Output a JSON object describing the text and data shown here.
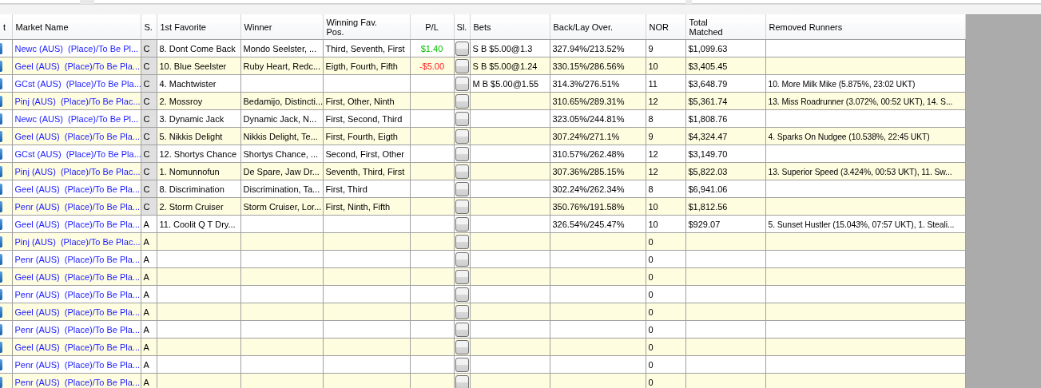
{
  "table": {
    "columns": [
      "t",
      "Market Name",
      "S.",
      "1st Favorite",
      "Winner",
      "Winning Fav.\nPos.",
      "P/L",
      "Sl.",
      "Bets",
      "Back/Lay Over.",
      "NOR",
      "Total\nMatched",
      "Removed Runners"
    ],
    "rows": [
      {
        "market": "Newc (AUS)  (Place)/To Be Pl...",
        "status": "C",
        "status_shaded": true,
        "favorite": "8. Dont Come Back",
        "winner": "Mondo Seelster, ...",
        "win_pos": "Third, Seventh, First",
        "pl": {
          "text": "$1.40",
          "color": "#00c000"
        },
        "bets": "S B $5.00@1.3",
        "back_lay": "327.94%/213.52%",
        "nor": "9",
        "total": "$1,099.63"
      },
      {
        "market": "Geel (AUS)  (Place)/To Be Pla...",
        "status": "C",
        "status_shaded": true,
        "favorite": "10. Blue Seelster",
        "winner": "Ruby Heart, Redc...",
        "win_pos": "Eigth, Fourth, Fifth",
        "pl": {
          "text": "-$5.00",
          "color": "#ff2020"
        },
        "bets": "S B $5.00@1.24",
        "back_lay": "330.15%/286.56%",
        "nor": "10",
        "total": "$3,405.45"
      },
      {
        "market": "GCst (AUS)  (Place)/To Be Pla...",
        "status": "C",
        "status_shaded": true,
        "favorite": "4. Machtwister",
        "bets": "M B $5.00@1.55",
        "back_lay": "314.3%/276.51%",
        "nor": "11",
        "total": "$3,648.79",
        "removed": "10. More Milk Mike (5.875%, 23:02 UKT)"
      },
      {
        "market": "Pinj (AUS)  (Place)/To Be Plac...",
        "status": "C",
        "status_shaded": true,
        "favorite": "2. Mossroy",
        "winner": "Bedamijo, Distincti...",
        "win_pos": "First, Other, Ninth",
        "back_lay": "310.65%/289.31%",
        "nor": "12",
        "total": "$5,361.74",
        "removed": "13. Miss Roadrunner (3.072%, 00:52 UKT), 14. S..."
      },
      {
        "market": "Newc (AUS)  (Place)/To Be Pl...",
        "status": "C",
        "status_shaded": true,
        "favorite": "3. Dynamic Jack",
        "winner": "Dynamic Jack, N...",
        "win_pos": "First, Second, Third",
        "back_lay": "323.05%/244.81%",
        "nor": "8",
        "total": "$1,808.76"
      },
      {
        "market": "Geel (AUS)  (Place)/To Be Pla...",
        "status": "C",
        "status_shaded": true,
        "favorite": "5. Nikkis Delight",
        "winner": "Nikkis Delight, Te...",
        "win_pos": "First, Fourth, Eigth",
        "back_lay": "307.24%/271.1%",
        "nor": "9",
        "total": "$4,324.47",
        "removed": "4. Sparks On Nudgee (10.538%, 22:45 UKT)"
      },
      {
        "market": "GCst (AUS)  (Place)/To Be Pla...",
        "status": "C",
        "status_shaded": true,
        "favorite": "12. Shortys Chance",
        "winner": "Shortys Chance, ...",
        "win_pos": "Second, First, Other",
        "back_lay": "310.57%/262.48%",
        "nor": "12",
        "total": "$3,149.70"
      },
      {
        "market": "Pinj (AUS)  (Place)/To Be Plac...",
        "status": "C",
        "status_shaded": true,
        "favorite": "1. Nomunnofun",
        "winner": "De Spare, Jaw Dr...",
        "win_pos": "Seventh, Third, First",
        "back_lay": "307.36%/285.15%",
        "nor": "12",
        "total": "$5,822.03",
        "removed": "13. Superior Speed (3.424%, 00:53 UKT), 11. Sw..."
      },
      {
        "market": "Geel (AUS)  (Place)/To Be Pla...",
        "status": "C",
        "status_shaded": true,
        "favorite": "8. Discrimination",
        "winner": "Discrimination, Ta...",
        "win_pos": "First, Third",
        "back_lay": "302.24%/262.34%",
        "nor": "8",
        "total": "$6,941.06"
      },
      {
        "market": "Penr (AUS)  (Place)/To Be Pla...",
        "status": "C",
        "status_shaded": true,
        "favorite": "2. Storm Cruiser",
        "winner": "Storm Cruiser, Lor...",
        "win_pos": "First, Ninth, Fifth",
        "back_lay": "350.76%/191.58%",
        "nor": "10",
        "total": "$1,812.56"
      },
      {
        "market": "Geel (AUS)  (Place)/To Be Pla...",
        "status": "A",
        "status_shaded": false,
        "favorite": "11. Coolit Q T Dry...",
        "back_lay": "326.54%/245.47%",
        "nor": "10",
        "total": "$929.07",
        "removed": "5. Sunset Hustler (15.043%, 07:57 UKT), 1. Steali..."
      },
      {
        "market": "Pinj (AUS)  (Place)/To Be Plac...",
        "status": "A",
        "status_shaded": false,
        "nor": "0"
      },
      {
        "market": "Penr (AUS)  (Place)/To Be Pla...",
        "status": "A",
        "status_shaded": false,
        "nor": "0"
      },
      {
        "market": "Geel (AUS)  (Place)/To Be Pla...",
        "status": "A",
        "status_shaded": false,
        "nor": "0"
      },
      {
        "market": "Penr (AUS)  (Place)/To Be Pla...",
        "status": "A",
        "status_shaded": false,
        "nor": "0"
      },
      {
        "market": "Geel (AUS)  (Place)/To Be Pla...",
        "status": "A",
        "status_shaded": false,
        "nor": "0"
      },
      {
        "market": "Penr (AUS)  (Place)/To Be Pla...",
        "status": "A",
        "status_shaded": false,
        "nor": "0"
      },
      {
        "market": "Geel (AUS)  (Place)/To Be Pla...",
        "status": "A",
        "status_shaded": false,
        "nor": "0"
      },
      {
        "market": "Penr (AUS)  (Place)/To Be Pla...",
        "status": "A",
        "status_shaded": false,
        "nor": "0"
      },
      {
        "market": "Penr (AUS)  (Place)/To Be Pla...",
        "status": "A",
        "status_shaded": false,
        "nor": "0"
      }
    ]
  }
}
